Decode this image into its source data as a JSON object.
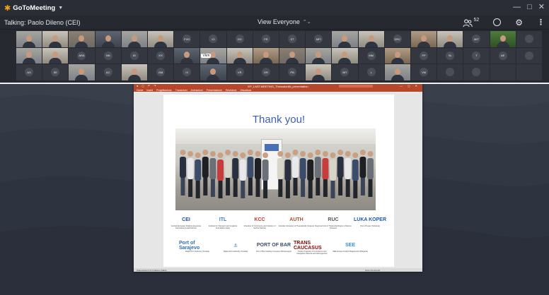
{
  "app": {
    "name": "GoToMeeting"
  },
  "window_controls": [
    "—",
    "□",
    "✕"
  ],
  "status": {
    "talking_label": "Talking: Paolo Dileno (CEI)",
    "view_label": "View Everyone",
    "participant_count": "52"
  },
  "participants": [
    {
      "kind": "video",
      "tone": "v2"
    },
    {
      "kind": "video",
      "tone": "v3"
    },
    {
      "kind": "video",
      "tone": "v1"
    },
    {
      "kind": "video",
      "tone": "v4"
    },
    {
      "kind": "video",
      "tone": "v2"
    },
    {
      "kind": "video",
      "tone": "v3"
    },
    {
      "kind": "initials",
      "text": "FVG"
    },
    {
      "kind": "initials",
      "text": "IO"
    },
    {
      "kind": "initials",
      "text": "GG"
    },
    {
      "kind": "initials",
      "text": "FR"
    },
    {
      "kind": "initials",
      "text": "ST"
    },
    {
      "kind": "initials",
      "text": "MFI"
    },
    {
      "kind": "video",
      "tone": "v2"
    },
    {
      "kind": "video",
      "tone": "v3"
    },
    {
      "kind": "initials",
      "text": "DRC"
    },
    {
      "kind": "video",
      "tone": "v5"
    },
    {
      "kind": "video",
      "tone": "v3"
    },
    {
      "kind": "initials",
      "text": "MIT"
    },
    {
      "kind": "video",
      "tone": "green"
    },
    {
      "kind": "initials",
      "text": ""
    },
    {
      "kind": "video",
      "tone": "v2"
    },
    {
      "kind": "video",
      "tone": "v3"
    },
    {
      "kind": "initials",
      "text": "ARA"
    },
    {
      "kind": "initials",
      "text": "NN"
    },
    {
      "kind": "initials",
      "text": "ID"
    },
    {
      "kind": "initials",
      "text": "KS"
    },
    {
      "kind": "video",
      "tone": "v4"
    },
    {
      "kind": "video",
      "tone": "v2"
    },
    {
      "kind": "video",
      "tone": "v3"
    },
    {
      "kind": "video",
      "tone": "v5"
    },
    {
      "kind": "video",
      "tone": "v1"
    },
    {
      "kind": "video",
      "tone": "v2"
    },
    {
      "kind": "video",
      "tone": "v3"
    },
    {
      "kind": "initials",
      "text": "MM"
    },
    {
      "kind": "video",
      "tone": "v5"
    },
    {
      "kind": "initials",
      "text": "FP"
    },
    {
      "kind": "initials",
      "text": "SL"
    },
    {
      "kind": "initials",
      "text": "T"
    },
    {
      "kind": "initials",
      "text": "AE"
    },
    {
      "kind": "initials",
      "text": ""
    },
    {
      "kind": "initials",
      "text": "AS"
    },
    {
      "kind": "initials",
      "text": "SE"
    },
    {
      "kind": "video",
      "tone": "v2"
    },
    {
      "kind": "initials",
      "text": "AC"
    },
    {
      "kind": "video",
      "tone": "v3"
    },
    {
      "kind": "initials",
      "text": "GM"
    },
    {
      "kind": "initials",
      "text": "CI"
    },
    {
      "kind": "video",
      "tone": "v4"
    },
    {
      "kind": "initials",
      "text": "VR"
    },
    {
      "kind": "initials",
      "text": "GR"
    },
    {
      "kind": "initials",
      "text": "PB"
    },
    {
      "kind": "video",
      "tone": "v3"
    },
    {
      "kind": "initials",
      "text": "BIT"
    },
    {
      "kind": "initials",
      "text": "L"
    },
    {
      "kind": "video",
      "tone": "v2"
    },
    {
      "kind": "initials",
      "text": "VM"
    },
    {
      "kind": "initials",
      "text": ""
    },
    {
      "kind": "initials",
      "text": ""
    },
    {
      "kind": "initials",
      "text": ""
    },
    {
      "kind": "initials",
      "text": ""
    }
  ],
  "mute_badge": "Vkm",
  "ppt": {
    "title": "EP_LAST.MEETING_Thessaloniki_presentation",
    "ribbon": [
      "Home",
      "Insert",
      "Progettazione",
      "Transizioni",
      "Animazioni",
      "Presentazione",
      "Revisione",
      "Visualizza"
    ],
    "status_left": "Diapositiva 9 di 9   Italiano (Italia)",
    "status_right": "Note   Commenti"
  },
  "slide": {
    "title": "Thank you!",
    "logos": [
      {
        "mark": "CEI",
        "color": "#1e4fa0",
        "caption": "Central European Initiative Executive Secretariat (Lead Partner)"
      },
      {
        "mark": "ITL",
        "color": "#3a79c0",
        "caption": "Institute for Transport and Logistics Foundation (Italy)"
      },
      {
        "mark": "KCC",
        "color": "#c0392b",
        "caption": "Chamber of Commerce and Industry of Serbia (Serbia)"
      },
      {
        "mark": "AUTH",
        "color": "#a0522d",
        "caption": "Aristotle University of Thessaloniki (Greece)"
      },
      {
        "mark": "RUC",
        "color": "#555555",
        "caption": "Regional Unit of Thesprotia Region of Epirus (Greece)"
      },
      {
        "mark": "LUKA KOPER",
        "color": "#1e5aa8",
        "caption": "Port of Koper (Slovenia)"
      },
      {
        "mark": "Port of Sarajevo",
        "color": "#2c6fb3",
        "caption": "Zadar Port Authority (Croatia)"
      },
      {
        "mark": "⚓",
        "color": "#2b83c6",
        "caption": "Rijeka Port Authority (Croatia)"
      },
      {
        "mark": "PORT OF BAR",
        "color": "#3d4a66",
        "caption": "Port of Bar Holding Company (Montenegro)"
      },
      {
        "mark": "TRANS CAUCASUS",
        "color": "#8b0000",
        "caption": "Trieste Chamber of Commerce and Navigation (Bosnia and Herzegovina)"
      },
      {
        "mark": "SEE",
        "color": "#3f8fd6",
        "caption": "SEE Europe Freight Bulgaria EU (Bulgaria)"
      }
    ]
  },
  "colors": {
    "accent": "#f7a21b",
    "ppt_red": "#b7472a",
    "slide_title": "#3c5db0"
  }
}
